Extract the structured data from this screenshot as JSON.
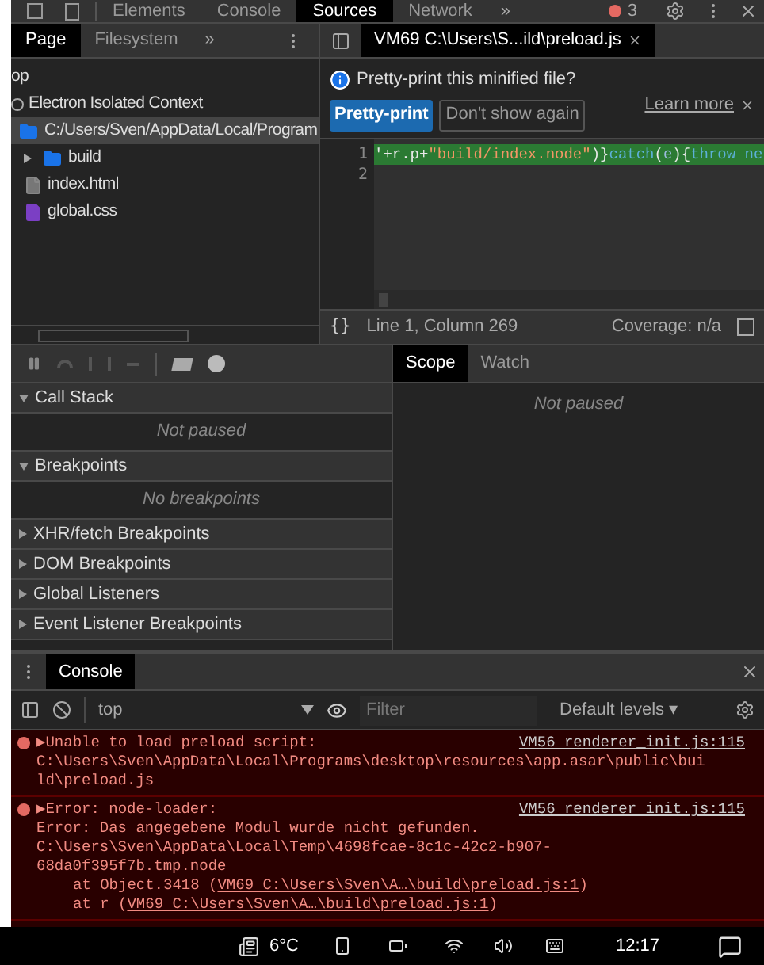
{
  "top_tabs": [
    {
      "label": "Elements",
      "selected": false
    },
    {
      "label": "Console",
      "selected": false
    },
    {
      "label": "Sources",
      "selected": true
    },
    {
      "label": "Network",
      "selected": false
    }
  ],
  "top_more": "»",
  "error_count": "3",
  "navigator": {
    "tabs": [
      {
        "label": "Page",
        "selected": true
      },
      {
        "label": "Filesystem",
        "selected": false
      }
    ],
    "more": "»",
    "tree": [
      {
        "label": "op",
        "kind": "frame",
        "selected": false,
        "children": [
          {
            "label": "Electron Isolated Context",
            "kind": "context",
            "selected": false,
            "children": [
              {
                "label": "C:/Users/Sven/AppData/Local/Program",
                "kind": "origin",
                "selected": true,
                "children": [
                  {
                    "label": "build",
                    "kind": "folder",
                    "selected": false
                  },
                  {
                    "label": "index.html",
                    "kind": "file",
                    "selected": false
                  },
                  {
                    "label": "global.css",
                    "kind": "css",
                    "selected": false
                  }
                ]
              }
            ]
          }
        ]
      }
    ]
  },
  "editor": {
    "tab": "VM69 C:\\Users\\S...ild\\preload.js",
    "infobar": {
      "message": "Pretty-print this minified file?",
      "primary": "Pretty-print",
      "secondary": "Don't show again",
      "link": "Learn more"
    },
    "line_numbers": [
      "1",
      "2"
    ],
    "code": [
      {
        "text": "'+r.p+",
        "kind": "plain"
      },
      {
        "text": "\"build/index.node\"",
        "kind": "string"
      },
      {
        "text": ")}",
        "kind": "plain"
      },
      {
        "text": "catch",
        "kind": "keyword"
      },
      {
        "text": "(",
        "kind": "plain"
      },
      {
        "text": "e",
        "kind": "variable"
      },
      {
        "text": "){",
        "kind": "plain"
      },
      {
        "text": "throw",
        "kind": "keyword"
      },
      {
        "text": " ne",
        "kind": "keyword"
      }
    ],
    "status": {
      "format": "{}",
      "position": "Line 1, Column 269",
      "coverage": "Coverage: n/a"
    }
  },
  "debugger": {
    "sections": [
      {
        "title": "Call Stack",
        "expanded": true,
        "empty": "Not paused"
      },
      {
        "title": "Breakpoints",
        "expanded": true,
        "empty": "No breakpoints"
      },
      {
        "title": "XHR/fetch Breakpoints",
        "expanded": false
      },
      {
        "title": "DOM Breakpoints",
        "expanded": false
      },
      {
        "title": "Global Listeners",
        "expanded": false
      },
      {
        "title": "Event Listener Breakpoints",
        "expanded": false
      }
    ],
    "side_tabs": [
      {
        "label": "Scope",
        "selected": true
      },
      {
        "label": "Watch",
        "selected": false
      }
    ],
    "side_empty": "Not paused"
  },
  "console": {
    "tab": "Console",
    "context": "top",
    "filter_placeholder": "Filter",
    "levels": "Default levels ▾",
    "messages": [
      {
        "head": "▶Unable to load preload script:",
        "source": "VM56 renderer_init.js:115",
        "lines": [
          "C:\\Users\\Sven\\AppData\\Local\\Programs\\desktop\\resources\\app.asar\\public\\bui",
          "ld\\preload.js"
        ]
      },
      {
        "head": "▶Error: node-loader:",
        "source": "VM56 renderer_init.js:115",
        "lines": [
          "Error: Das angegebene Modul wurde nicht gefunden.",
          "C:\\Users\\Sven\\AppData\\Local\\Temp\\4698fcae-8c1c-42c2-b907-",
          "68da0f395f7b.tmp.node"
        ],
        "stack": [
          {
            "prefix": "at Object.3418 (",
            "link": "VM69 C:\\Users\\Sven\\A…\\build\\preload.js:1",
            "suffix": ")"
          },
          {
            "prefix": "at r (",
            "link": "VM69 C:\\Users\\Sven\\A…\\build\\preload.js:1",
            "suffix": ")"
          }
        ]
      }
    ]
  },
  "taskbar": {
    "weather": "6°C",
    "time": "12:17"
  }
}
